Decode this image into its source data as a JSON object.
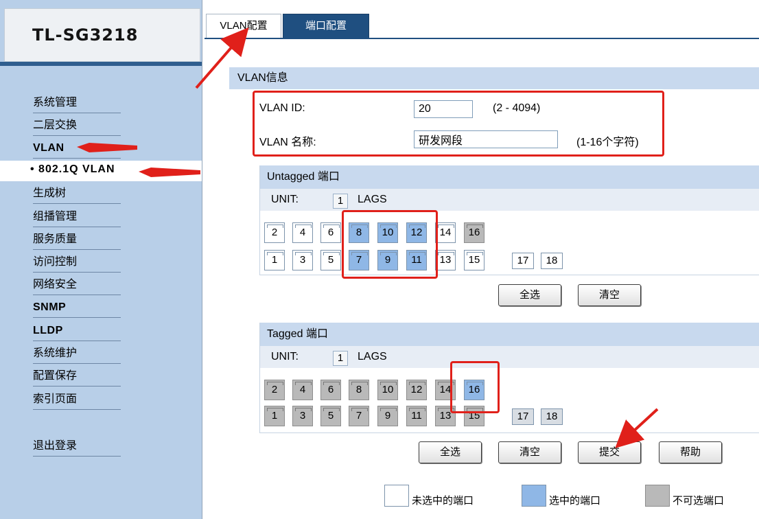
{
  "app": {
    "title": "TL-SG3218"
  },
  "sidebar": {
    "items": [
      {
        "label": "系统管理"
      },
      {
        "label": "二层交换"
      },
      {
        "label": "VLAN"
      },
      {
        "label": "• 802.1Q VLAN"
      },
      {
        "label": "生成树"
      },
      {
        "label": "组播管理"
      },
      {
        "label": "服务质量"
      },
      {
        "label": "访问控制"
      },
      {
        "label": "网络安全"
      },
      {
        "label": "SNMP"
      },
      {
        "label": "LLDP"
      },
      {
        "label": "系统维护"
      },
      {
        "label": "配置保存"
      },
      {
        "label": "索引页面"
      },
      {
        "label": "退出登录"
      }
    ]
  },
  "tabs": [
    {
      "label": "VLAN配置",
      "active": true
    },
    {
      "label": "端口配置",
      "active": false
    }
  ],
  "vlan_info": {
    "title": "VLAN信息",
    "id_label": "VLAN ID:",
    "id_value": "20",
    "id_hint": "(2 - 4094)",
    "name_label": "VLAN 名称:",
    "name_value": "研发网段",
    "name_hint": "(1-16个字符)"
  },
  "untagged": {
    "title": "Untagged 端口",
    "unit_label": "UNIT:",
    "unit_value": "1",
    "lags_label": "LAGS",
    "ports_top": [
      {
        "num": "2",
        "state": "unselected"
      },
      {
        "num": "4",
        "state": "unselected"
      },
      {
        "num": "6",
        "state": "unselected"
      },
      {
        "num": "8",
        "state": "selected"
      },
      {
        "num": "10",
        "state": "selected"
      },
      {
        "num": "12",
        "state": "selected"
      },
      {
        "num": "14",
        "state": "unselected"
      },
      {
        "num": "16",
        "state": "unavailable"
      }
    ],
    "ports_bottom": [
      {
        "num": "1",
        "state": "unselected"
      },
      {
        "num": "3",
        "state": "unselected"
      },
      {
        "num": "5",
        "state": "unselected"
      },
      {
        "num": "7",
        "state": "selected"
      },
      {
        "num": "9",
        "state": "selected"
      },
      {
        "num": "11",
        "state": "selected"
      },
      {
        "num": "13",
        "state": "unselected"
      },
      {
        "num": "15",
        "state": "unselected"
      }
    ],
    "extra": [
      "17",
      "18"
    ],
    "buttons": {
      "select_all": "全选",
      "clear": "清空"
    }
  },
  "tagged": {
    "title": "Tagged 端口",
    "unit_label": "UNIT:",
    "unit_value": "1",
    "lags_label": "LAGS",
    "ports_top": [
      {
        "num": "2",
        "state": "unavailable"
      },
      {
        "num": "4",
        "state": "unavailable"
      },
      {
        "num": "6",
        "state": "unavailable"
      },
      {
        "num": "8",
        "state": "unavailable"
      },
      {
        "num": "10",
        "state": "unavailable"
      },
      {
        "num": "12",
        "state": "unavailable"
      },
      {
        "num": "14",
        "state": "unavailable"
      },
      {
        "num": "16",
        "state": "selected"
      }
    ],
    "ports_bottom": [
      {
        "num": "1",
        "state": "unavailable"
      },
      {
        "num": "3",
        "state": "unavailable"
      },
      {
        "num": "5",
        "state": "unavailable"
      },
      {
        "num": "7",
        "state": "unavailable"
      },
      {
        "num": "9",
        "state": "unavailable"
      },
      {
        "num": "11",
        "state": "unavailable"
      },
      {
        "num": "13",
        "state": "unavailable"
      },
      {
        "num": "15",
        "state": "unavailable"
      }
    ],
    "extra": [
      "17",
      "18"
    ],
    "buttons": {
      "select_all": "全选",
      "clear": "清空",
      "submit": "提交",
      "help": "帮助"
    }
  },
  "legend": {
    "unselected": "未选中的端口",
    "selected": "选中的端口",
    "unavailable": "不可选端口"
  },
  "colors": {
    "sidebar_bg": "#b8cfe8",
    "tab_active_bg": "#ffffff",
    "tab_inactive_bg": "#1f4f80",
    "port_selected": "#8fb7e6",
    "port_unavailable": "#b9b9b9",
    "annotation": "#e0201a"
  }
}
